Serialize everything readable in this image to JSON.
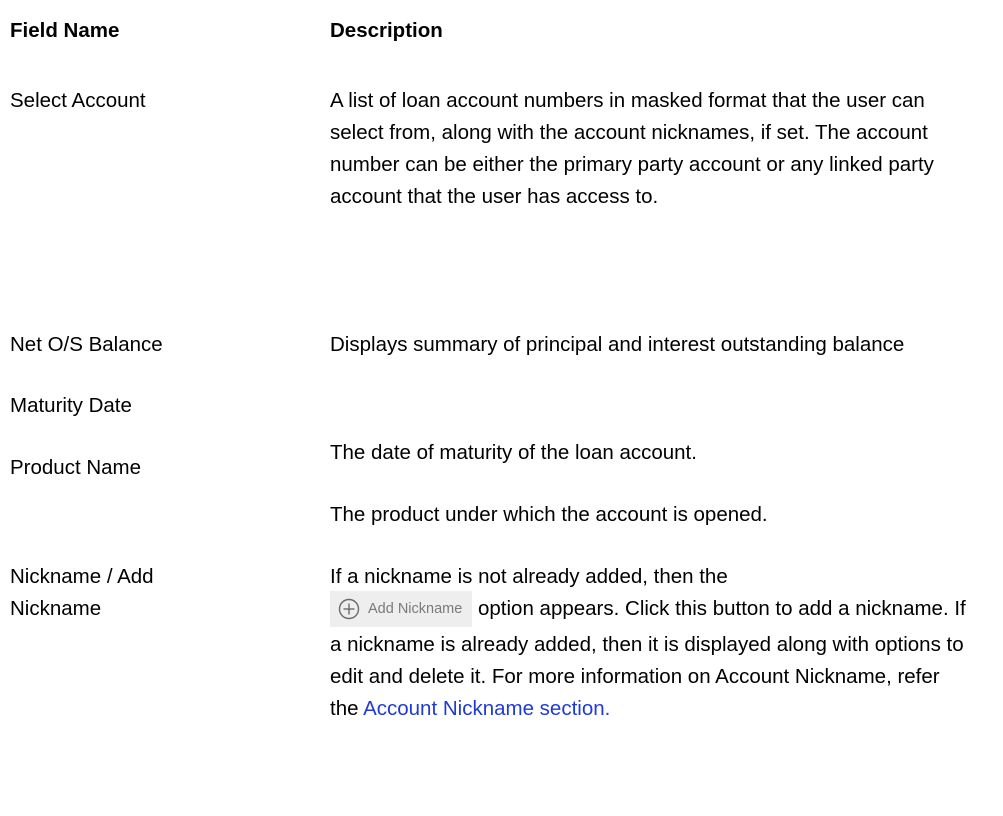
{
  "table": {
    "header": {
      "field_name": "Field Name",
      "description": "Description"
    },
    "rows": [
      {
        "field": "Select Account",
        "description": "A list of loan account numbers in masked format that the user can select from, along with the account nicknames, if set. The account number can be either the primary party account or any linked party account that the user has access to."
      },
      {
        "field": "Net O/S Balance",
        "description": "Displays summary of principal and interest outstanding balance"
      },
      {
        "field": "Maturity Date",
        "description": "The date of maturity of the loan account."
      },
      {
        "field": "Product Name",
        "description": "The product under which the account is opened."
      },
      {
        "field": "Nickname / Add Nickname",
        "description_part1": "If a nickname is not already added, then the",
        "button_label": "Add Nickname",
        "button_icon": "plus-circle-icon",
        "description_part2": "option appears. Click this button to add a nickname. If a nickname is already added, then it is displayed along with options to edit and delete it. For more information on Account Nickname, refer the",
        "link_text": "Account Nickname section."
      }
    ]
  },
  "colors": {
    "link": "#1f3bd6",
    "button_bg": "#eeeeee",
    "button_text": "#7a7a7a"
  }
}
